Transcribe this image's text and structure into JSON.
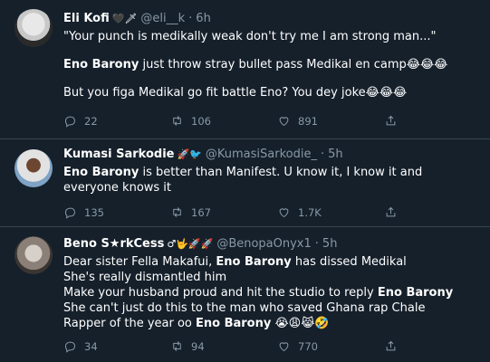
{
  "tweets": [
    {
      "name": "Eli Kofi",
      "name_emoji": "🖤🗡",
      "handle": "@eli__k",
      "time": "6h",
      "lines": [
        "\"Your punch is medikally weak don't try me I am strong man...\"",
        "Eno Barony just throw stray bullet pass Medikal en camp😂😂😂",
        "But you figa Medikal go fit battle Eno? You dey joke😂😂😂"
      ],
      "bold_phrase": "Eno Barony",
      "replies": "22",
      "retweets": "106",
      "likes": "891"
    },
    {
      "name": "Kumasi Sarkodie",
      "name_emoji": "🚀🐦",
      "handle": "@KumasiSarkodie_",
      "time": "5h",
      "text_bold": "Eno Barony",
      "text_rest": " is better than Manifest. U know it, I know it and everyone knows it",
      "replies": "135",
      "retweets": "167",
      "likes": "1.7K"
    },
    {
      "name": "Beno S★rkCess",
      "name_emoji": "♂🤟🚀🚀",
      "handle": "@BenopaOnyx1",
      "time": "5h",
      "line1_a": "Dear sister Fella Makafui, ",
      "line1_b": "Eno Barony",
      "line1_c": " has dissed Medikal",
      "line2": "She's really dismantled him",
      "line3_a": "Make your husband proud and hit the studio to reply ",
      "line3_b": "Eno Barony",
      "line4": "She can't just do this to the man who saved Ghana rap Chale",
      "line5_a": "Rapper of the year oo ",
      "line5_b": "Eno Barony",
      "line5_c": " 😭😩😹🤣",
      "replies": "34",
      "retweets": "94",
      "likes": "770"
    }
  ]
}
